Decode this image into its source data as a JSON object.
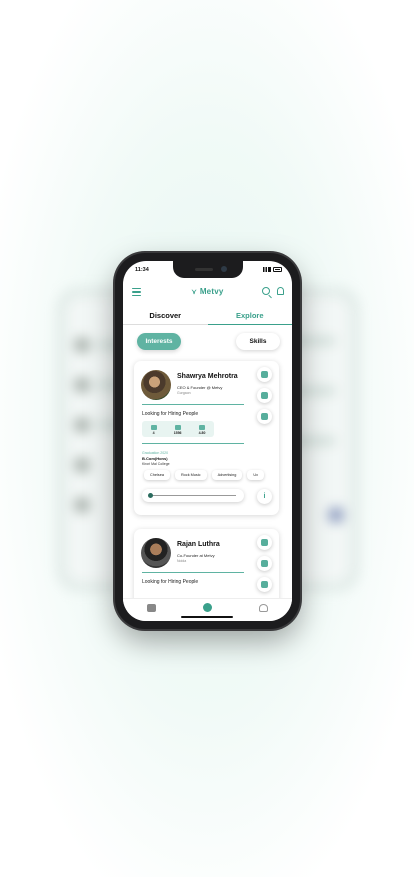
{
  "status": {
    "time": "11:34"
  },
  "header": {
    "brand": "Metvy"
  },
  "tabs": [
    {
      "label": "Discover",
      "active": false
    },
    {
      "label": "Explore",
      "active": true
    }
  ],
  "filters": {
    "interests": "Interests",
    "skills": "Skills",
    "selected": "Interests"
  },
  "cards": [
    {
      "name": "Shawrya Mehrotra",
      "role": "CEO & Founder @ Metvy",
      "location": "Gurgaon",
      "looking": "Looking for Hiring People",
      "stats": [
        {
          "icon": "bar-chart-icon",
          "value": "4"
        },
        {
          "icon": "people-icon",
          "value": "1556"
        },
        {
          "icon": "star-icon",
          "value": "4.80"
        }
      ],
      "graduation_label": "Graduation 2020",
      "degree": "B.Com(Hons)",
      "college": "Kirori Mal College",
      "tags": [
        "Chelsea",
        "Rock Music",
        "Advertising",
        "Ux"
      ],
      "slider_level": 0.02
    },
    {
      "name": "Rajan Luthra",
      "role": "Co-Founder at Metvy",
      "location": "Noida",
      "looking": "Looking for Hiring People"
    }
  ],
  "colors": {
    "accent": "#3aa08b",
    "pill_active": "#5fb3a2"
  }
}
